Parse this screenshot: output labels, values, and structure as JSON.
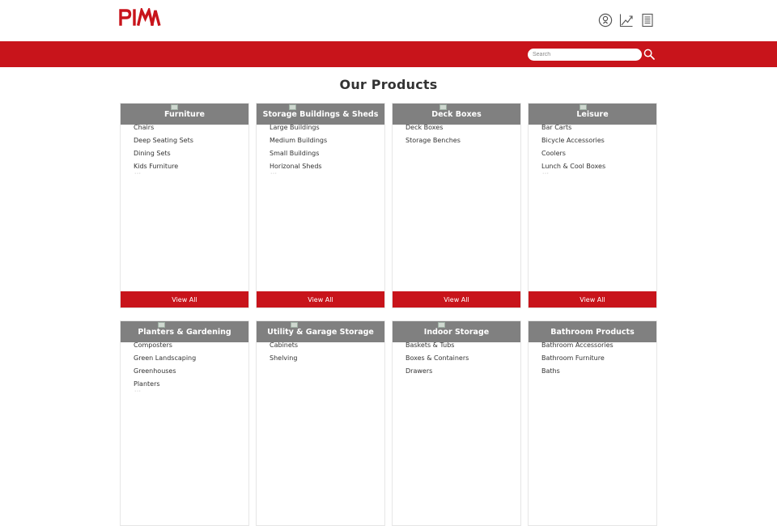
{
  "brand": {
    "logo_text": "PIM",
    "accent": "#c8141b",
    "header_gray": "#808080"
  },
  "header_icons": [
    "user-icon",
    "chart-icon",
    "notes-icon"
  ],
  "search": {
    "placeholder": "Search"
  },
  "page": {
    "title": "Our Products"
  },
  "categories": [
    {
      "title": "Furniture",
      "items": [
        "Chairs",
        "Deep Seating Sets",
        "Dining Sets",
        "Kids Furniture"
      ],
      "more": "···",
      "view_all": "View All"
    },
    {
      "title": "Storage Buildings & Sheds",
      "items": [
        "Large Buildings",
        "Medium Buildings",
        "Small Buildings",
        "Horizonal Sheds"
      ],
      "more": "···",
      "view_all": "View All"
    },
    {
      "title": "Deck Boxes",
      "items": [
        "Deck Boxes",
        "Storage Benches"
      ],
      "view_all": "View All"
    },
    {
      "title": "Leisure",
      "items": [
        "Bar Carts",
        "Bicycle Accessories",
        "Coolers",
        "Lunch & Cool Boxes"
      ],
      "more": "···",
      "view_all": "View All"
    },
    {
      "title": "Planters & Gardening",
      "items": [
        "Composters",
        "Green Landscaping",
        "Greenhouses",
        "Planters"
      ],
      "more": "···"
    },
    {
      "title": "Utility & Garage Storage",
      "items": [
        "Cabinets",
        "Shelving"
      ]
    },
    {
      "title": "Indoor Storage",
      "items": [
        "Baskets & Tubs",
        "Boxes & Containers",
        "Drawers"
      ]
    },
    {
      "title": "Bathroom Products",
      "items": [
        "Bathroom Accessories",
        "Bathroom Furniture",
        "Baths"
      ]
    }
  ]
}
